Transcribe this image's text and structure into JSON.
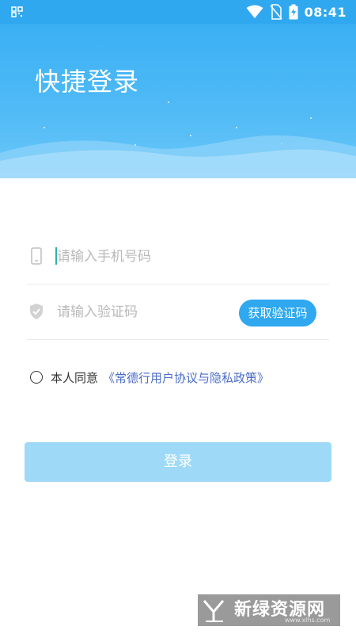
{
  "status_bar": {
    "time": "08:41",
    "icons": [
      "qr-icon",
      "wifi-icon",
      "no-sim-icon",
      "battery-charging-icon"
    ]
  },
  "header": {
    "title": "快捷登录"
  },
  "form": {
    "phone": {
      "placeholder": "请输入手机号码",
      "value": "",
      "icon": "phone-icon"
    },
    "code": {
      "placeholder": "请输入验证码",
      "value": "",
      "icon": "shield-icon",
      "button_label": "获取验证码"
    }
  },
  "agreement": {
    "checked": false,
    "text": "本人同意",
    "link": "《常德行用户协议与隐私政策》"
  },
  "login": {
    "label": "登录"
  },
  "watermark": {
    "text": "新绿资源网",
    "url": "www.xlhs.com"
  },
  "colors": {
    "accent": "#2FA8F0",
    "login_disabled": "#9FD9F8",
    "link": "#4A6CC7"
  }
}
